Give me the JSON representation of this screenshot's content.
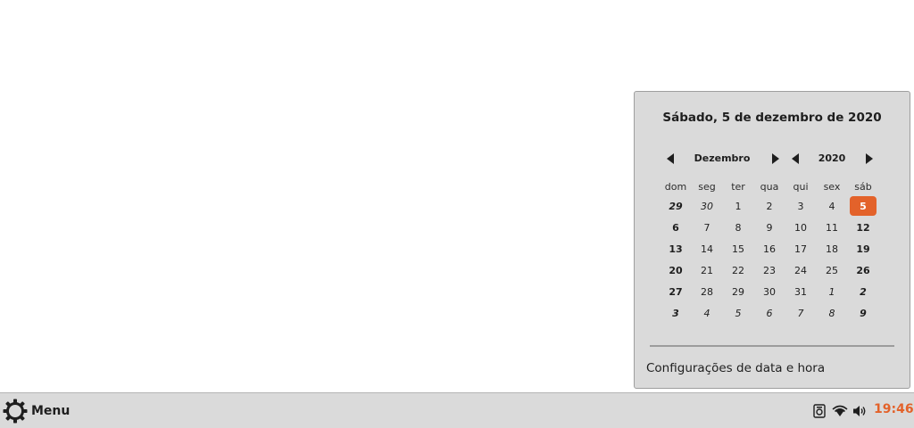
{
  "calendar": {
    "heading": "Sábado, 5 de dezembro de 2020",
    "month_label": "Dezembro",
    "year_label": "2020",
    "weekday_headers": [
      "dom",
      "seg",
      "ter",
      "qua",
      "qui",
      "sex",
      "sáb"
    ],
    "weeks": [
      [
        {
          "d": "29",
          "other": true
        },
        {
          "d": "30",
          "other": true
        },
        {
          "d": "1"
        },
        {
          "d": "2"
        },
        {
          "d": "3"
        },
        {
          "d": "4"
        },
        {
          "d": "5",
          "today": true
        }
      ],
      [
        {
          "d": "6"
        },
        {
          "d": "7"
        },
        {
          "d": "8"
        },
        {
          "d": "9"
        },
        {
          "d": "10"
        },
        {
          "d": "11"
        },
        {
          "d": "12"
        }
      ],
      [
        {
          "d": "13"
        },
        {
          "d": "14"
        },
        {
          "d": "15"
        },
        {
          "d": "16"
        },
        {
          "d": "17"
        },
        {
          "d": "18"
        },
        {
          "d": "19"
        }
      ],
      [
        {
          "d": "20"
        },
        {
          "d": "21"
        },
        {
          "d": "22"
        },
        {
          "d": "23"
        },
        {
          "d": "24"
        },
        {
          "d": "25"
        },
        {
          "d": "26"
        }
      ],
      [
        {
          "d": "27"
        },
        {
          "d": "28"
        },
        {
          "d": "29"
        },
        {
          "d": "30"
        },
        {
          "d": "31"
        },
        {
          "d": "1",
          "other": true
        },
        {
          "d": "2",
          "other": true
        }
      ],
      [
        {
          "d": "3",
          "other": true
        },
        {
          "d": "4",
          "other": true
        },
        {
          "d": "5",
          "other": true
        },
        {
          "d": "6",
          "other": true
        },
        {
          "d": "7",
          "other": true
        },
        {
          "d": "8",
          "other": true
        },
        {
          "d": "9",
          "other": true
        }
      ]
    ],
    "settings_link": "Configurações de data e hora",
    "today_color": "#e3622a"
  },
  "taskbar": {
    "menu_label": "Menu",
    "menu_icon": "gear-icon",
    "tray_icons": [
      "screenshot-icon",
      "wifi-icon",
      "volume-icon"
    ],
    "clock": "19:46",
    "clock_color": "#e3622a"
  }
}
